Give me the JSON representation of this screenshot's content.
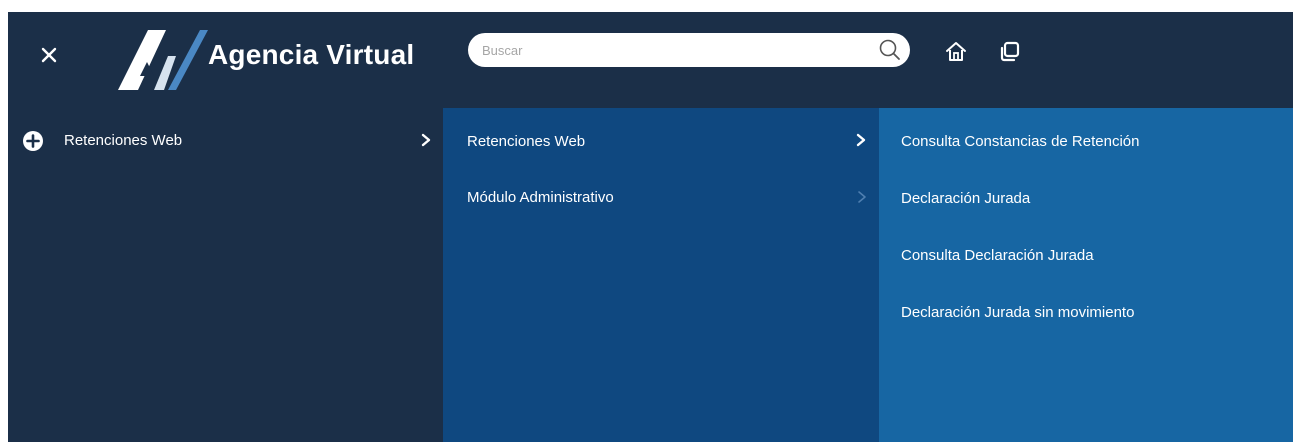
{
  "header": {
    "brand": "Agencia Virtual",
    "logo_text": "AV",
    "search_placeholder": "Buscar",
    "icons": [
      "close-icon",
      "search-icon",
      "home-icon",
      "windows-icon"
    ]
  },
  "menu_level1": {
    "items": [
      {
        "label": "Retenciones Web",
        "icon": "plus-circle-icon",
        "has_submenu": true
      }
    ]
  },
  "menu_level2": {
    "items": [
      {
        "label": "Retenciones Web",
        "has_submenu": true,
        "active": true
      },
      {
        "label": "Módulo Administrativo",
        "has_submenu": true,
        "active": false
      }
    ]
  },
  "menu_level3": {
    "items": [
      {
        "label": "Consulta Constancias de Retención"
      },
      {
        "label": "Declaración Jurada"
      },
      {
        "label": "Consulta Declaración Jurada"
      },
      {
        "label": "Declaración Jurada sin movimiento"
      }
    ]
  },
  "colors": {
    "header_bg": "#1b2f48",
    "col1_bg": "#1b2f48",
    "col2_bg": "#0f4880",
    "col3_bg": "#1766a3",
    "text": "#ffffff"
  }
}
